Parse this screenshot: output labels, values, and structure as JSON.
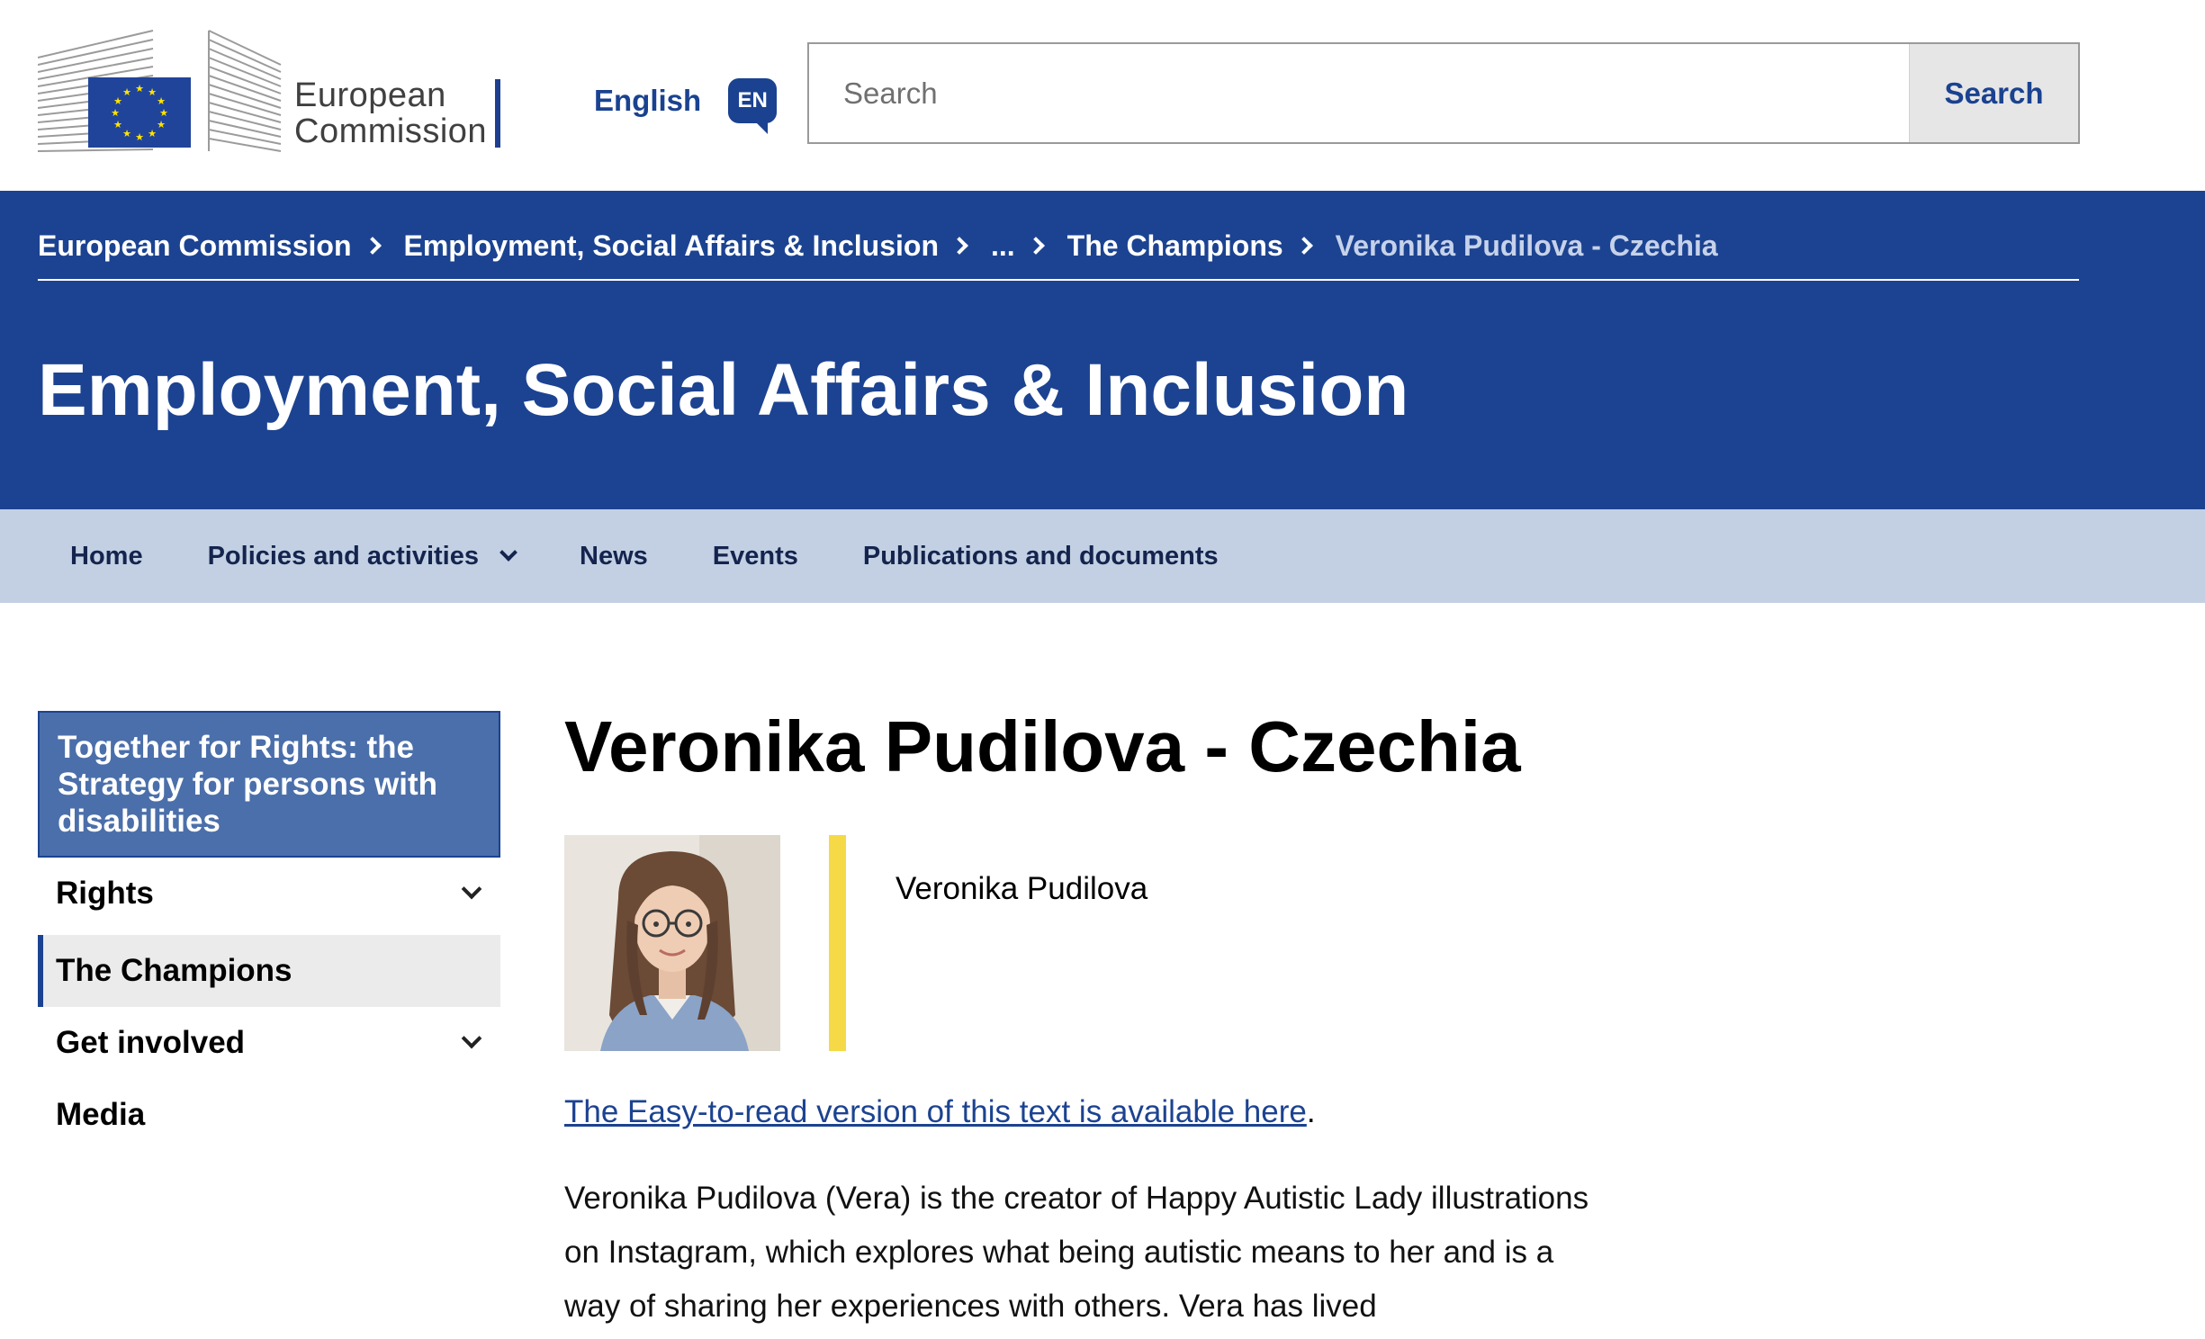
{
  "header": {
    "logo_line1": "European",
    "logo_line2": "Commission",
    "language_label": "English",
    "language_code": "EN",
    "search_placeholder": "Search",
    "search_button": "Search"
  },
  "breadcrumb": {
    "items": [
      "European Commission",
      "Employment, Social Affairs & Inclusion",
      "...",
      "The Champions"
    ],
    "current": "Veronika Pudilova - Czechia"
  },
  "site_title": "Employment, Social Affairs & Inclusion",
  "nav": {
    "items": [
      "Home",
      "Policies and activities",
      "News",
      "Events",
      "Publications and documents"
    ]
  },
  "sidebar": {
    "heading": "Together for Rights: the Strategy for persons with disabilities",
    "items": [
      "Rights",
      "The Champions",
      "Get involved",
      "Media"
    ]
  },
  "main": {
    "title": "Veronika Pudilova - Czechia",
    "profile_name": "Veronika Pudilova",
    "easy_read_link": "The Easy-to-read version of this text is available here",
    "easy_read_suffix": ".",
    "paragraph": "Veronika Pudilova (Vera) is the creator of Happy Autistic Lady illustrations on Instagram, which explores what being autistic means to her and is a way of sharing her experiences with others. Vera has lived"
  },
  "colors": {
    "banner_blue": "#1c4391",
    "nav_bg": "#c3d0e3",
    "sidebar_head": "#4b6faa",
    "accent_yellow": "#f6d946",
    "link_blue": "#1c4391"
  },
  "icons": [
    "eu-flag-icon",
    "speech-bubble-icon",
    "chevron-right-icon",
    "chevron-down-icon"
  ]
}
